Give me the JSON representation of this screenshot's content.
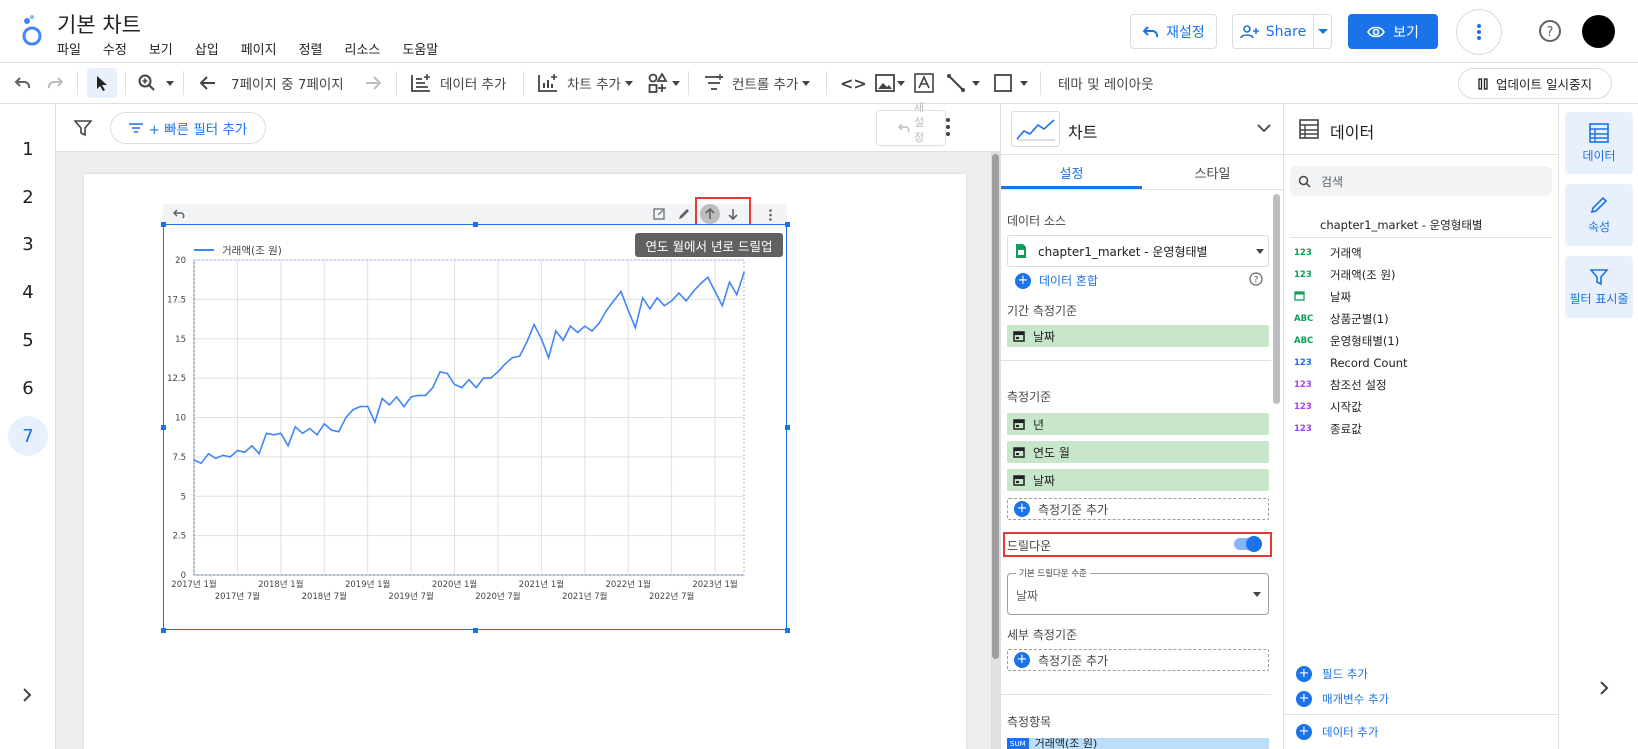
{
  "app": {
    "title": "기본 차트",
    "menu": [
      "파일",
      "수정",
      "보기",
      "삽입",
      "페이지",
      "정렬",
      "리소스",
      "도움말"
    ],
    "reset_label": "재설정",
    "share_label": "Share",
    "view_label": "보기"
  },
  "toolbar": {
    "page_nav": "7페이지 중 7페이지",
    "add_data": "데이터 추가",
    "add_chart": "차트 추가",
    "add_control": "컨트롤 추가",
    "theme_layout": "테마 및 레이아웃",
    "pause_updates": "업데이트 일시중지"
  },
  "pages": [
    "1",
    "2",
    "3",
    "4",
    "5",
    "6",
    "7"
  ],
  "active_page": "7",
  "filterbar": {
    "quick_filter": "+ 빠른 필터 추가",
    "reset_mini": [
      "새",
      "설",
      "정"
    ]
  },
  "chart": {
    "legend": "거래액(조 원)",
    "tooltip": "연도 월에서 년로 드릴업"
  },
  "chart_data": {
    "type": "line",
    "series": [
      {
        "name": "거래액(조 원)",
        "color": "#4285f4",
        "values": [
          7.3,
          7.1,
          7.7,
          7.4,
          7.6,
          7.5,
          7.9,
          7.8,
          8.2,
          7.7,
          9.0,
          8.9,
          9.0,
          8.2,
          9.4,
          9.0,
          9.3,
          8.9,
          9.6,
          9.2,
          9.1,
          10.0,
          10.5,
          10.7,
          10.7,
          9.7,
          11.2,
          10.8,
          11.3,
          10.7,
          11.3,
          11.4,
          11.4,
          11.9,
          12.9,
          12.8,
          12.1,
          11.9,
          12.4,
          11.9,
          12.5,
          12.5,
          12.9,
          13.4,
          13.8,
          13.9,
          14.8,
          15.9,
          15.0,
          13.8,
          15.5,
          14.9,
          15.8,
          15.4,
          15.8,
          15.5,
          16.0,
          16.8,
          17.4,
          18.0,
          16.8,
          15.7,
          17.6,
          16.9,
          17.6,
          17.1,
          17.4,
          17.9,
          17.4,
          18.0,
          18.5,
          18.9,
          18.0,
          17.1,
          18.6,
          17.8,
          19.2
        ]
      }
    ],
    "x_ticks_top": [
      "2017년 1월",
      "2018년 1월",
      "2019년 1월",
      "2020년 1월",
      "2021년 1월",
      "2022년 1월",
      "2023년 1월"
    ],
    "x_ticks_bottom": [
      "2017년 7월",
      "2018년 7월",
      "2019년 7월",
      "2020년 7월",
      "2021년 7월",
      "2022년 7월"
    ],
    "y_ticks": [
      "0",
      "2.5",
      "5",
      "7.5",
      "10",
      "12.5",
      "15",
      "17.5",
      "20"
    ],
    "ylim": [
      0,
      20
    ],
    "grid": true,
    "legend_position": "top-left"
  },
  "props_panel": {
    "chart_type_label": "차트",
    "tabs": [
      "설정",
      "스타일"
    ],
    "data_source_label": "데이터 소스",
    "data_source_value": "chapter1_market - 운영형태별",
    "blend_label": "데이터 혼합",
    "date_range_label": "기간 측정기준",
    "date_range_value": "날짜",
    "dimension_label": "측정기준",
    "dimensions": [
      "년",
      "연도 월",
      "날짜"
    ],
    "add_dimension": "측정기준 추가",
    "drilldown_label": "드릴다운",
    "default_drill_label": "기본 드릴다운 수준",
    "default_drill_value": "날짜",
    "breakdown_label": "세부 측정기준",
    "add_breakdown": "측정기준 추가",
    "metric_label": "측정항목",
    "metric_value": "거래액(조 원)"
  },
  "data_panel": {
    "title": "데이터",
    "search_placeholder": "검색",
    "source": "chapter1_market - 운영형태별",
    "fields": [
      {
        "type": "123",
        "name": "거래액",
        "kind": "abc"
      },
      {
        "type": "123",
        "name": "거래액(조 원)",
        "kind": "abc"
      },
      {
        "type": "date",
        "name": "날짜",
        "kind": "abc"
      },
      {
        "type": "ABC",
        "name": "상품군별(1)",
        "kind": "abc"
      },
      {
        "type": "ABC",
        "name": "운영형태별(1)",
        "kind": "abc"
      },
      {
        "type": "123",
        "name": "Record Count",
        "kind": "num"
      },
      {
        "type": "123",
        "name": "참조선 설정",
        "kind": "pur"
      },
      {
        "type": "123",
        "name": "시작값",
        "kind": "pur"
      },
      {
        "type": "123",
        "name": "종료값",
        "kind": "pur"
      }
    ],
    "add_field": "필드 추가",
    "add_param": "매개변수 추가",
    "add_data": "데이터 추가"
  },
  "side_nav": [
    "데이터",
    "속성",
    "필터 표시줄"
  ]
}
